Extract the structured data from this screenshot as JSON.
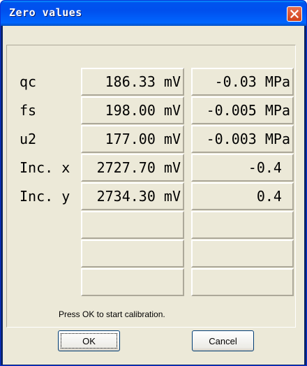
{
  "window": {
    "title": "Zero values"
  },
  "rows": [
    {
      "label": "qc",
      "raw": "186.33 mV",
      "value": "-0.03 MPa"
    },
    {
      "label": "fs",
      "raw": "198.00 mV",
      "value": "-0.005 MPa"
    },
    {
      "label": "u2",
      "raw": "177.00 mV",
      "value": "-0.003 MPa"
    },
    {
      "label": "Inc. x",
      "raw": "2727.70 mV",
      "value": "-0.4 "
    },
    {
      "label": "Inc. y",
      "raw": "2734.30 mV",
      "value": "0.4 "
    },
    {
      "label": "",
      "raw": "",
      "value": ""
    },
    {
      "label": "",
      "raw": "",
      "value": ""
    },
    {
      "label": "",
      "raw": "",
      "value": ""
    }
  ],
  "footer": {
    "prompt": "Press OK to start calibration.",
    "ok_mnemonic": "O",
    "ok_rest": "K",
    "cancel_mnemonic": "C",
    "cancel_rest": "ancel"
  },
  "colors": {
    "titlebar": "#0055ea",
    "close_button": "#d8532b",
    "dialog_face": "#ece9d8"
  },
  "icons": {
    "close": "close-icon"
  }
}
